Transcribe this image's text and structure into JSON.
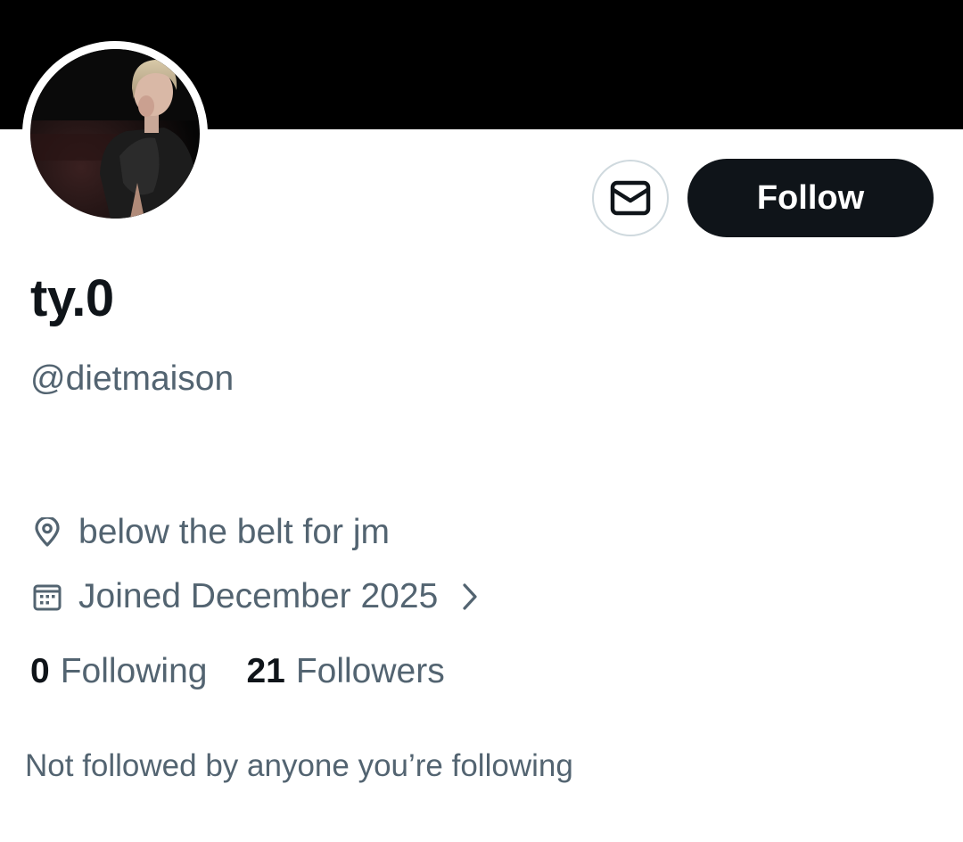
{
  "profile": {
    "display_name": "ty.0",
    "handle": "@dietmaison",
    "location": "below the belt for jm",
    "joined": "Joined December 2025",
    "following_count": "0",
    "following_label": "Following",
    "followers_count": "21",
    "followers_label": "Followers",
    "mutuals_note": "Not followed by anyone you’re following"
  },
  "actions": {
    "follow_label": "Follow",
    "message_icon": "envelope-icon"
  },
  "icons": {
    "location": "location-pin-icon",
    "joined": "calendar-icon",
    "joined_chevron": "chevron-right-icon"
  },
  "colors": {
    "banner": "#000000",
    "follow_bg": "#0f1419",
    "secondary_text": "#536471",
    "primary_text": "#0f1419",
    "border": "#cfd9de"
  }
}
